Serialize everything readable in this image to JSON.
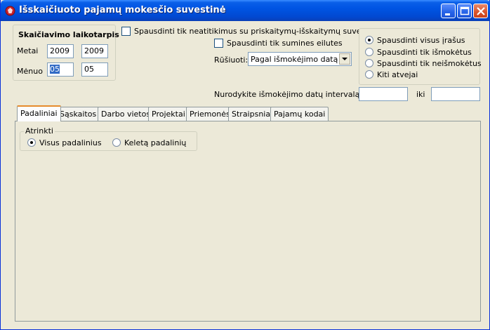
{
  "window": {
    "title": "Išskaičiuoto pajamų mokesčio suvestinė",
    "icons": [
      "app-icon",
      "minimize-icon",
      "maximize-icon",
      "close-icon"
    ]
  },
  "period": {
    "title": "Skaičiavimo laikotarpis",
    "year_label": "Metai",
    "year_from": "2009",
    "year_to": "2009",
    "month_label": "Mėnuo",
    "month_from": "05",
    "month_to": "05"
  },
  "options": {
    "mismatch_label": "Spausdinti tik neatitikimus su priskaitymų-išskaitymų suvestine",
    "mismatch_checked": false,
    "totals_label": "Spausdinti tik sumines eilutes",
    "totals_checked": false,
    "sort_label": "Rūšiuoti:",
    "sort_value": "Pagal išmokėjimo datą"
  },
  "print_mode": {
    "options": [
      {
        "label": "Spausdinti visus įrašus",
        "selected": true
      },
      {
        "label": "Spausdinti tik išmokėtus",
        "selected": false
      },
      {
        "label": "Spausdinti tik neišmokėtus",
        "selected": false
      },
      {
        "label": "Kiti atvejai",
        "selected": false
      }
    ]
  },
  "interval": {
    "label": "Nurodykite išmokėjimo datų intervalą nuo",
    "from": "",
    "to_label": "iki",
    "to": ""
  },
  "tabs": [
    {
      "label": "Padaliniai",
      "active": true
    },
    {
      "label": "Sąskaitos",
      "active": false
    },
    {
      "label": "Darbo vietos",
      "active": false
    },
    {
      "label": "Projektai",
      "active": false
    },
    {
      "label": "Priemonės",
      "active": false
    },
    {
      "label": "Straipsniai",
      "active": false
    },
    {
      "label": "Pajamų kodai",
      "active": false
    }
  ],
  "select_group": {
    "title": "Atrinkti",
    "all_label": "Visus padalinius",
    "all_selected": true,
    "some_label": "Keletą padalinių",
    "some_selected": false
  }
}
